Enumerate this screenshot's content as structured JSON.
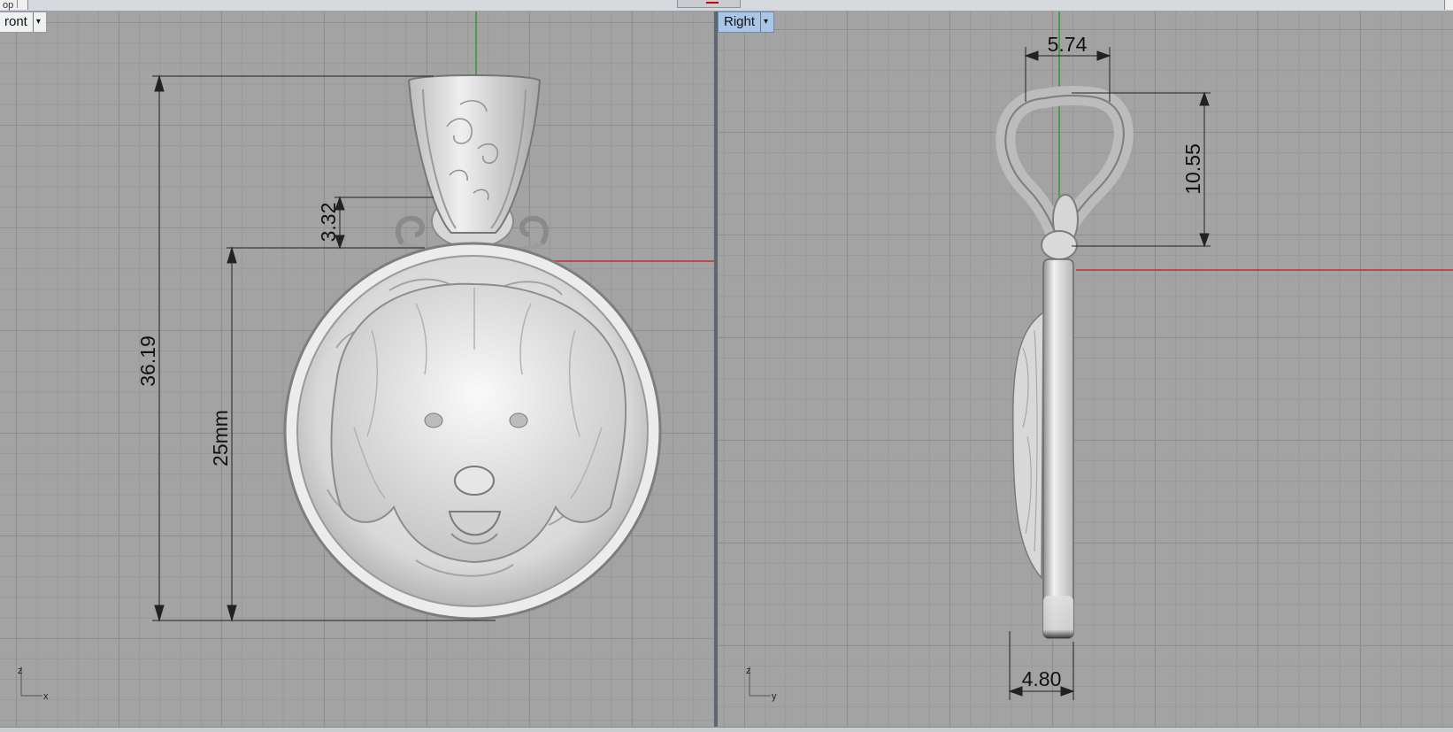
{
  "top_tab": {
    "label": "op"
  },
  "viewports": {
    "front": {
      "label": "ront",
      "dimensions": {
        "overall_height": "36.19",
        "disc": "25mm",
        "bail_gap": "3.32"
      },
      "axes": {
        "vertical": "z",
        "horizontal": "x"
      }
    },
    "right": {
      "label": "Right",
      "dimensions": {
        "bail_width": "5.74",
        "bail_height": "10.55",
        "thickness": "4.80"
      },
      "axes": {
        "vertical": "z",
        "horizontal": "y"
      }
    }
  },
  "colors": {
    "x_axis": "#c03030",
    "z_axis": "#2e9a2e",
    "grid_major": "#8f8f8f",
    "grid_minor": "#999999",
    "active_label": "#a9c6e6"
  }
}
